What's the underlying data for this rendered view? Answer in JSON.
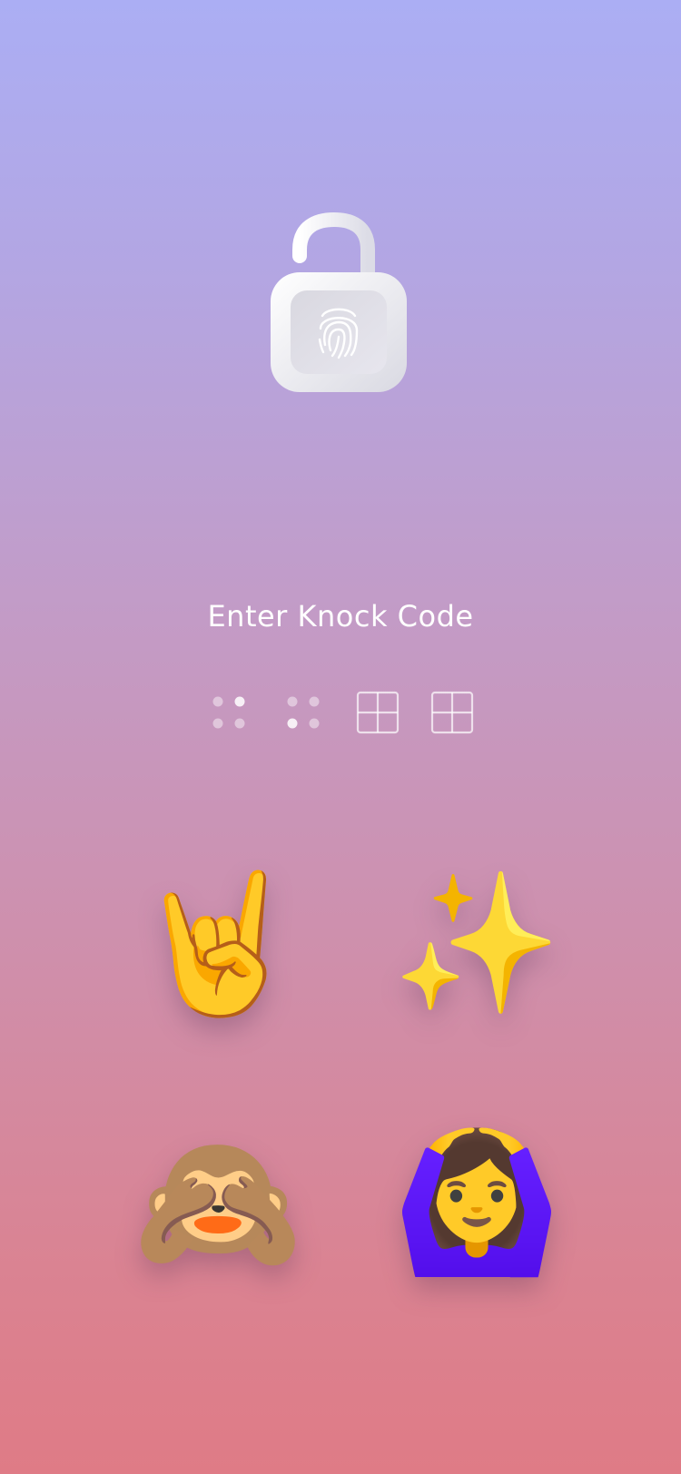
{
  "lock": {
    "icon": "unlocked-padlock-fingerprint-icon"
  },
  "title": "Enter Knock Code",
  "progress": {
    "icons": [
      "knock-dots-icon",
      "knock-dots-icon",
      "knock-grid-icon",
      "knock-grid-icon"
    ]
  },
  "knock_buttons": [
    {
      "label": "🤘",
      "icon": "sign-of-horns-emoji"
    },
    {
      "label": "✨",
      "icon": "sparkles-emoji"
    },
    {
      "label": "🙈",
      "icon": "see-no-evil-monkey-emoji"
    },
    {
      "label": "🙆‍♀️",
      "icon": "woman-gesturing-ok-emoji"
    }
  ],
  "colors": {
    "background_top": "#abaef4",
    "background_bottom": "#df7b86",
    "foreground": "#ffffff"
  }
}
